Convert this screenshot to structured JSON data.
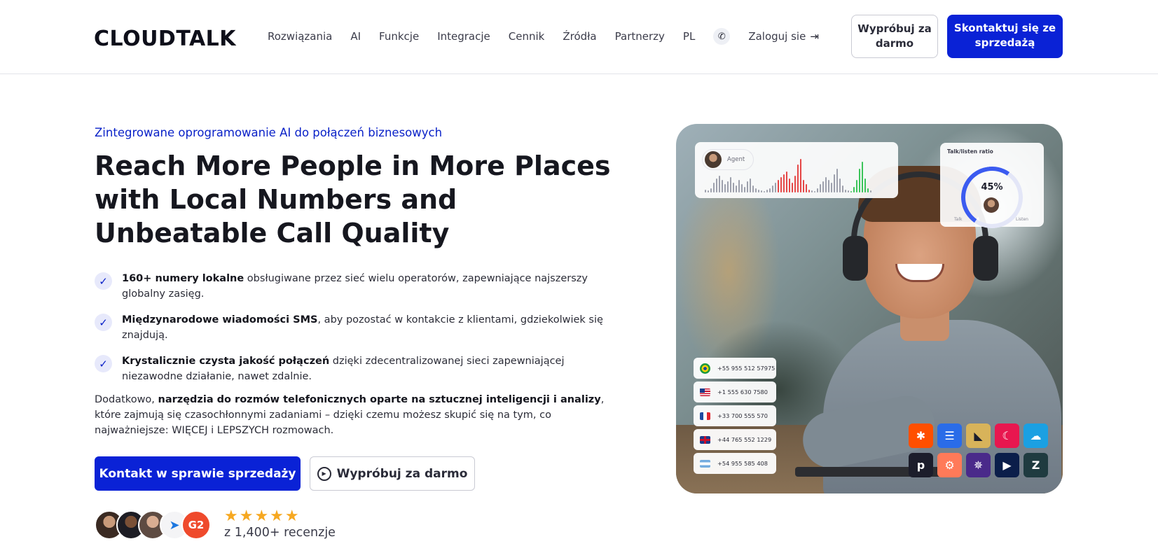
{
  "header": {
    "logo": "CLOUDTALK",
    "nav": [
      "Rozwiązania",
      "AI",
      "Funkcje",
      "Integracje",
      "Cennik",
      "Źródła",
      "Partnerzy",
      "PL"
    ],
    "login": "Zaloguj sie",
    "try_button": "Wypróbuj za darmo",
    "contact_button": "Skontaktuj się ze sprzedażą"
  },
  "hero": {
    "eyebrow": "Zintegrowane oprogramowanie AI do połączeń biznesowych",
    "title": "Reach More People in More Places with Local Numbers and Unbeatable Call Quality",
    "features": [
      {
        "bold": "160+ numery lokalne",
        "text": " obsługiwane przez sieć wielu operatorów, zapewniające najszerszy globalny zasięg."
      },
      {
        "bold": "Międzynarodowe wiadomości SMS",
        "text": ", aby pozostać w kontakcie z klientami, gdziekolwiek się znajdują."
      },
      {
        "bold": "Krystalicznie czysta jakość połączeń",
        "text": " dzięki zdecentralizowanej sieci zapewniającej niezawodne działanie, nawet zdalnie."
      }
    ],
    "extra_prefix": "Dodatkowo, ",
    "extra_bold": "narzędzia do rozmów telefonicznych oparte na sztucznej inteligencji i analizy",
    "extra_suffix": ", które zajmują się czasochłonnymi zadaniami – dzięki czemu możesz skupić się na tym, co najważniejsze: WIĘCEJ i LEPSZYCH rozmowach.",
    "primary_button": "Kontakt w sprawie sprzedaży",
    "secondary_button": "Wypróbuj za darmo",
    "rating_stars": 5,
    "stars": "★★★★★",
    "reviews": "z 1,400+ recenzje",
    "g2_badge": "G2"
  },
  "visual": {
    "agent_label": "Agent",
    "ratio_title": "Talk/listen ratio",
    "ratio_value": "45%",
    "ratio_talk": "Talk",
    "ratio_listen": "Listen",
    "phone_numbers": [
      {
        "flag": "br",
        "number": "+55 955 512 57975"
      },
      {
        "flag": "us",
        "number": "+1 555 630 7580"
      },
      {
        "flag": "fr",
        "number": "+33 700 555 570"
      },
      {
        "flag": "gb",
        "number": "+44 765 552 1229"
      },
      {
        "flag": "ar",
        "number": "+54 955 585 408"
      }
    ],
    "integration_icons": [
      "zapier-icon",
      "intercom-icon",
      "pipedrive-logo-icon",
      "clearbit-icon",
      "salesforce-icon",
      "pipedrive-icon",
      "hubspot-icon",
      "shopify-star-icon",
      "dynamics-icon",
      "zendesk-icon"
    ]
  },
  "colors": {
    "brand_blue": "#0a22d6",
    "star_gold": "#f6a821",
    "g2_red": "#ef4a2c"
  }
}
